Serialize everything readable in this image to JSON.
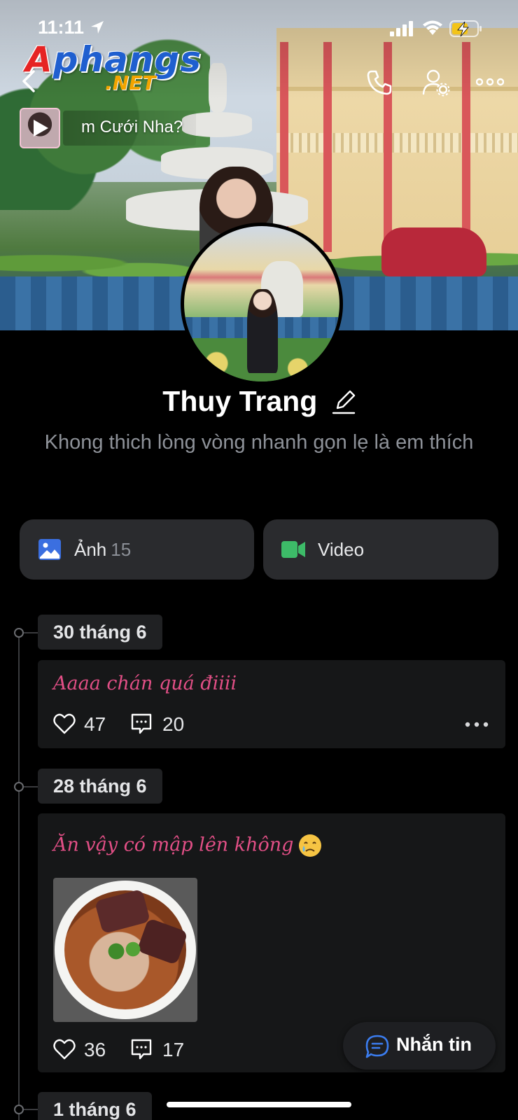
{
  "status_bar": {
    "time": "11:11"
  },
  "watermark": {
    "line1": "Aphangs",
    "line2": ".NET"
  },
  "music": {
    "title": "m Cưới Nha?"
  },
  "profile": {
    "name": "Thuy Trang",
    "bio": "Khong thich lòng vòng nhanh gọn lẹ là em thích"
  },
  "media": {
    "photos_label": "Ảnh",
    "photos_count": "15",
    "videos_label": "Video"
  },
  "timeline": [
    {
      "date": "30 tháng 6",
      "text": "Aaaa chán quá điiii",
      "likes": "47",
      "comments": "20"
    },
    {
      "date": "28 tháng 6",
      "text": "Ăn vậy có mập lên không",
      "likes": "36",
      "comments": "17"
    },
    {
      "date": "1 tháng 6"
    }
  ],
  "message_button": {
    "label": "Nhắn tin"
  },
  "colors": {
    "accent_blue": "#3b6fe0",
    "video_green": "#3dbb68",
    "post_pink": "#e24f86",
    "background": "#000000"
  }
}
